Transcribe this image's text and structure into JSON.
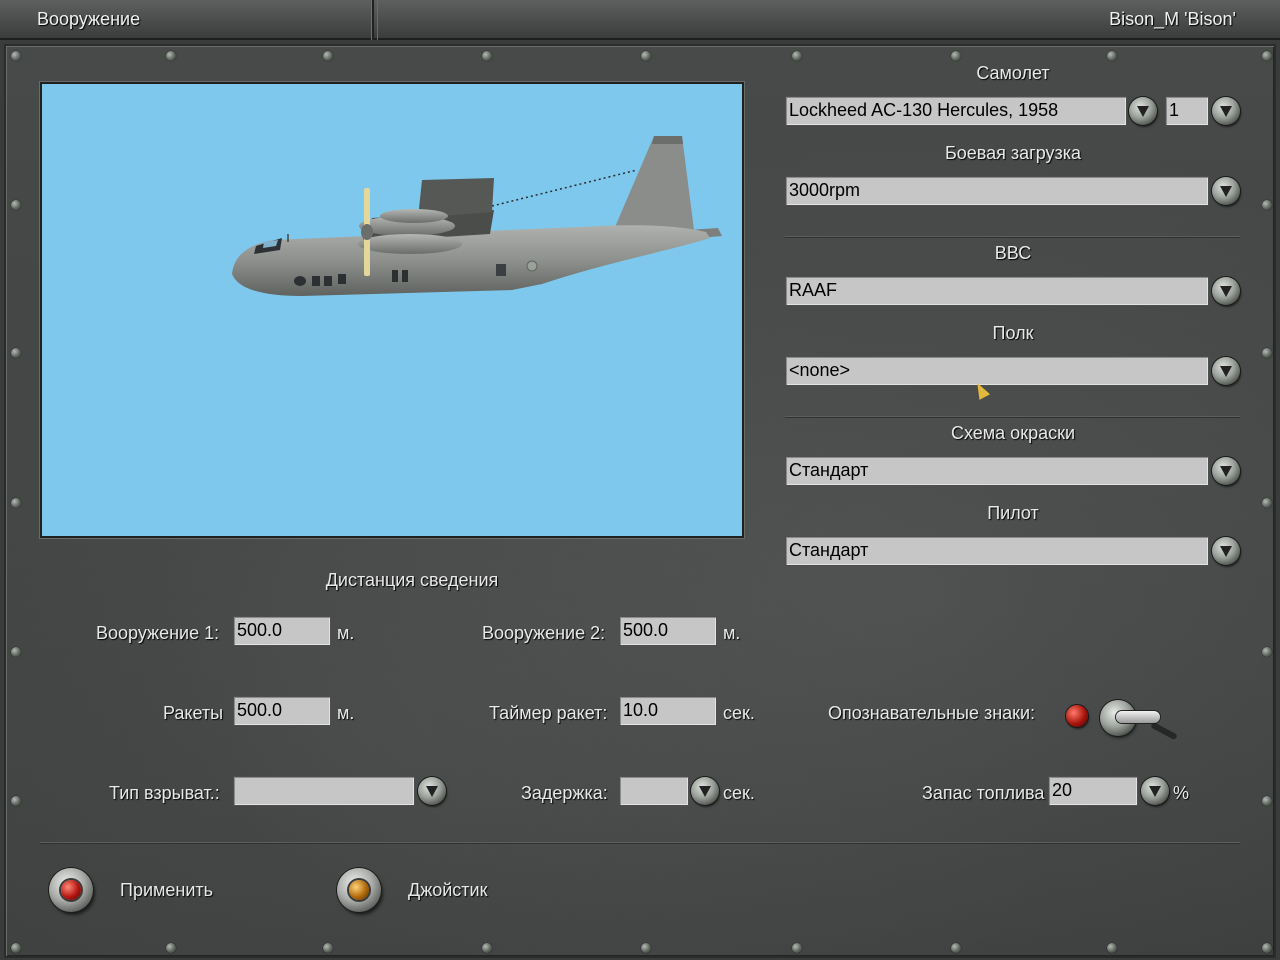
{
  "window": {
    "title": "Вооружение",
    "player": "Bison_M 'Bison'"
  },
  "aircraft_panel": {
    "aircraft_label": "Самолет",
    "aircraft_value": "Lockheed AC-130 Hercules, 1958",
    "count_value": "1",
    "loadout_label": "Боевая загрузка",
    "loadout_value": "3000rpm",
    "airforce_label": "ВВС",
    "airforce_value": "RAAF",
    "regiment_label": "Полк",
    "regiment_value": "<none>",
    "skin_label": "Схема окраски",
    "skin_value": "Стандарт",
    "pilot_label": "Пилот",
    "pilot_value": "Стандарт"
  },
  "convergence": {
    "heading": "Дистанция сведения",
    "weapon1_label": "Вооружение 1:",
    "weapon1_value": "500.0",
    "weapon2_label": "Вооружение 2:",
    "weapon2_value": "500.0",
    "rockets_label": "Ракеты",
    "rockets_value": "500.0",
    "rocket_timer_label": "Таймер ракет:",
    "rocket_timer_value": "10.0",
    "fuse_type_label": "Тип взрыват.:",
    "fuse_type_value": "",
    "delay_label": "Задержка:",
    "delay_value": "",
    "unit_m": "м.",
    "unit_sec": "сек.",
    "markings_label": "Опознавательные знаки:",
    "fuel_label": "Запас топлива",
    "fuel_value": "20",
    "unit_percent": "%"
  },
  "actions": {
    "apply_label": "Применить",
    "joystick_label": "Джойстик"
  },
  "colors": {
    "sky": "#7ec8ee",
    "panel": "#444646",
    "field": "#c6c6c6",
    "lamp_red": "#b21610",
    "lamp_amber": "#b06a0a"
  }
}
